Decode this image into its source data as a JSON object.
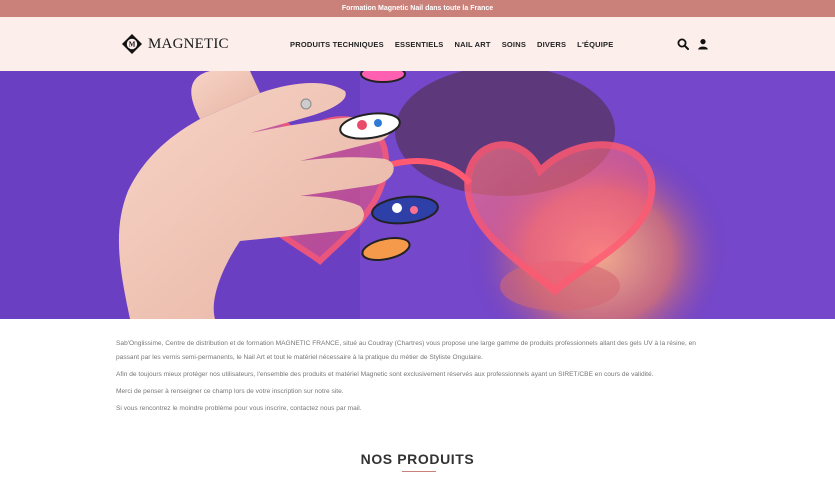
{
  "topbar": {
    "text": "Formation Magnetic Nail dans toute la France"
  },
  "header": {
    "logo_text": "MAGNETIC",
    "nav": [
      {
        "label": "PRODUITS TECHNIQUES"
      },
      {
        "label": "ESSENTIELS"
      },
      {
        "label": "NAIL ART"
      },
      {
        "label": "SOINS"
      },
      {
        "label": "DIVERS"
      },
      {
        "label": "L'ÉQUIPE"
      }
    ],
    "icons": [
      "search-icon",
      "user-icon"
    ]
  },
  "hero": {
    "alt_subject": "hand-with-nail-art-and-heart-sunglasses"
  },
  "intro": {
    "paragraphs": [
      "Sab'Onglissime, Centre de distribution et de formation MAGNETIC FRANCE, situé au Coudray (Chartres) vous propose une large gamme de produits professionnels allant des gels UV à la résine, en passant par les vernis semi-permanents, le Nail Art et tout le matériel nécessaire à la pratique du métier de Styliste Ongulaire.",
      "Afin de toujours mieux protéger nos utilisateurs, l'ensemble des produits et matériel Magnetic sont exclusivement réservés aux professionnels ayant un SIRET/CBE en cours de validité.",
      "Merci de penser à renseigner ce champ lors de votre inscription sur notre site.",
      "Si vous rencontrez le moindre problème pour vous inscrire, contactez nous par mail."
    ]
  },
  "products": {
    "title": "NOS PRODUITS"
  },
  "colors": {
    "topbar": "#c9817a",
    "header_bg": "#fbeeeb",
    "hero_bg": "#6b3fc2",
    "accent": "#c9817a"
  }
}
